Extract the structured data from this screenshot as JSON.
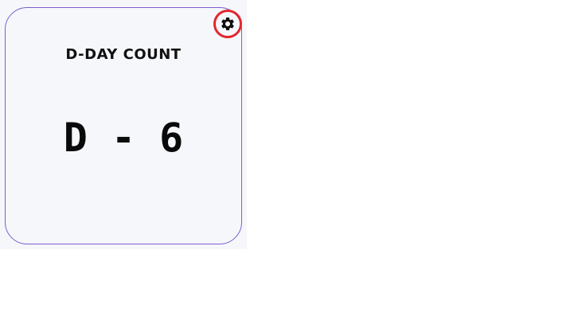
{
  "widget": {
    "title": "D-DAY COUNT",
    "count_text": "D - 6",
    "settings_icon": "gear-icon",
    "colors": {
      "card_border": "#7b5fd0",
      "card_background": "#f6f7fb",
      "settings_highlight": "#e3262f"
    }
  }
}
